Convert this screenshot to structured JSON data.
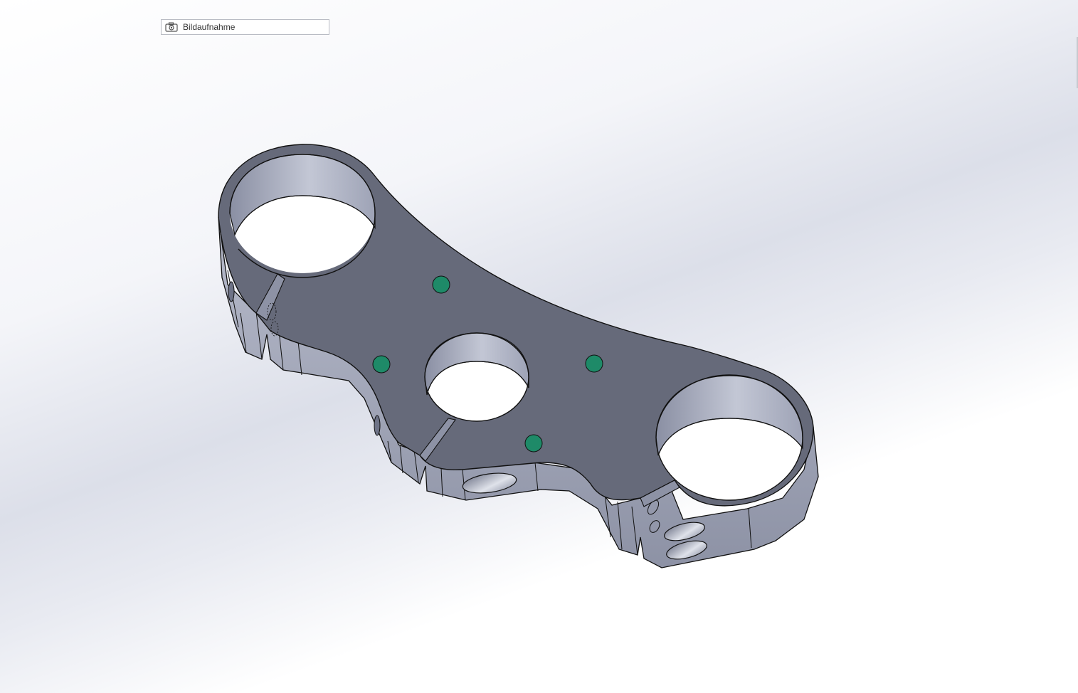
{
  "capture_box": {
    "label": "Bildaufnahme",
    "icon": "camera-icon"
  },
  "colors": {
    "background_top": "#ffffff",
    "background_mid": "#dcdfe9",
    "part_top_face": "#666a7a",
    "part_side_face": "#9a9fb1",
    "part_bore_inner": "#a6abbd",
    "dowel_pins": "#1e8a68",
    "edge": "#111111"
  }
}
